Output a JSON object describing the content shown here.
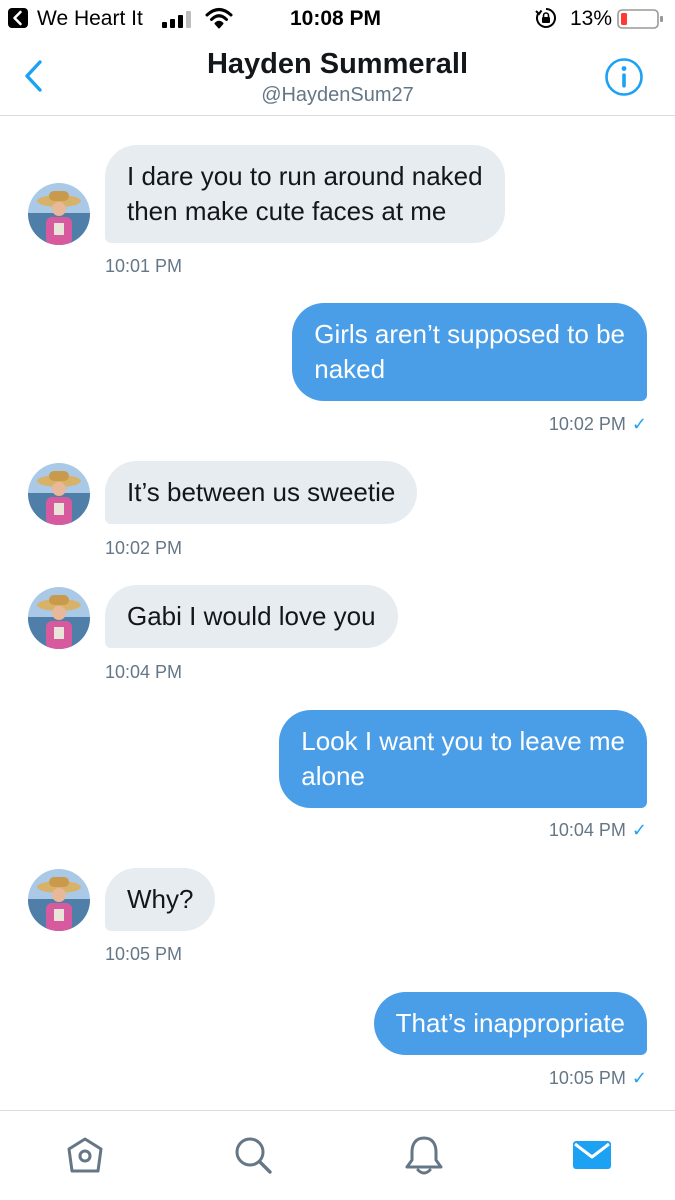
{
  "status_bar": {
    "back_app": "We Heart It",
    "time": "10:08 PM",
    "battery": "13%"
  },
  "header": {
    "name": "Hayden Summerall",
    "handle": "@HaydenSum27"
  },
  "messages": [
    {
      "dir": "in",
      "lines": [
        "I dare you to run around naked",
        "then make cute faces at me"
      ],
      "time": "10:01 PM"
    },
    {
      "dir": "out",
      "lines": [
        "Girls aren’t supposed to be",
        "naked"
      ],
      "time": "10:02 PM"
    },
    {
      "dir": "in",
      "lines": [
        "It’s between us sweetie"
      ],
      "time": "10:02 PM"
    },
    {
      "dir": "in",
      "lines": [
        "Gabi I would love you"
      ],
      "time": "10:04 PM"
    },
    {
      "dir": "out",
      "lines": [
        "Look I want you to leave me",
        "alone"
      ],
      "time": "10:04 PM"
    },
    {
      "dir": "in",
      "lines": [
        "Why?"
      ],
      "time": "10:05 PM"
    },
    {
      "dir": "out",
      "lines": [
        "That’s inappropriate"
      ],
      "time": "10:05 PM"
    }
  ],
  "read_check": "✓",
  "tabs": [
    {
      "icon": "home-icon"
    },
    {
      "icon": "search-icon"
    },
    {
      "icon": "notifications-bell-icon"
    },
    {
      "icon": "messages-envelope-icon"
    }
  ],
  "colors": {
    "accent": "#1da1f2",
    "outgoing_bubble": "#4a9ee8",
    "incoming_bubble": "#e6ecf0",
    "muted_text": "#657786"
  }
}
